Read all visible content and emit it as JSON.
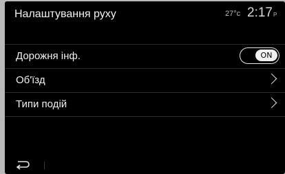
{
  "header": {
    "title": "Налаштування руху",
    "temperature": "27°c",
    "time": "2:17",
    "ampm": "P"
  },
  "menu": {
    "items": [
      {
        "label": "Дорожня інф.",
        "control": "toggle",
        "toggle_label": "ON"
      },
      {
        "label": "Об'їзд",
        "control": "chevron"
      },
      {
        "label": "Типи подій",
        "control": "chevron"
      }
    ]
  },
  "icons": {
    "back": "back-arrow-icon",
    "chevron": "chevron-right-icon"
  },
  "colors": {
    "background": "#000000",
    "text": "#f2f2f2",
    "toggle_on": "#f2f2f2"
  }
}
